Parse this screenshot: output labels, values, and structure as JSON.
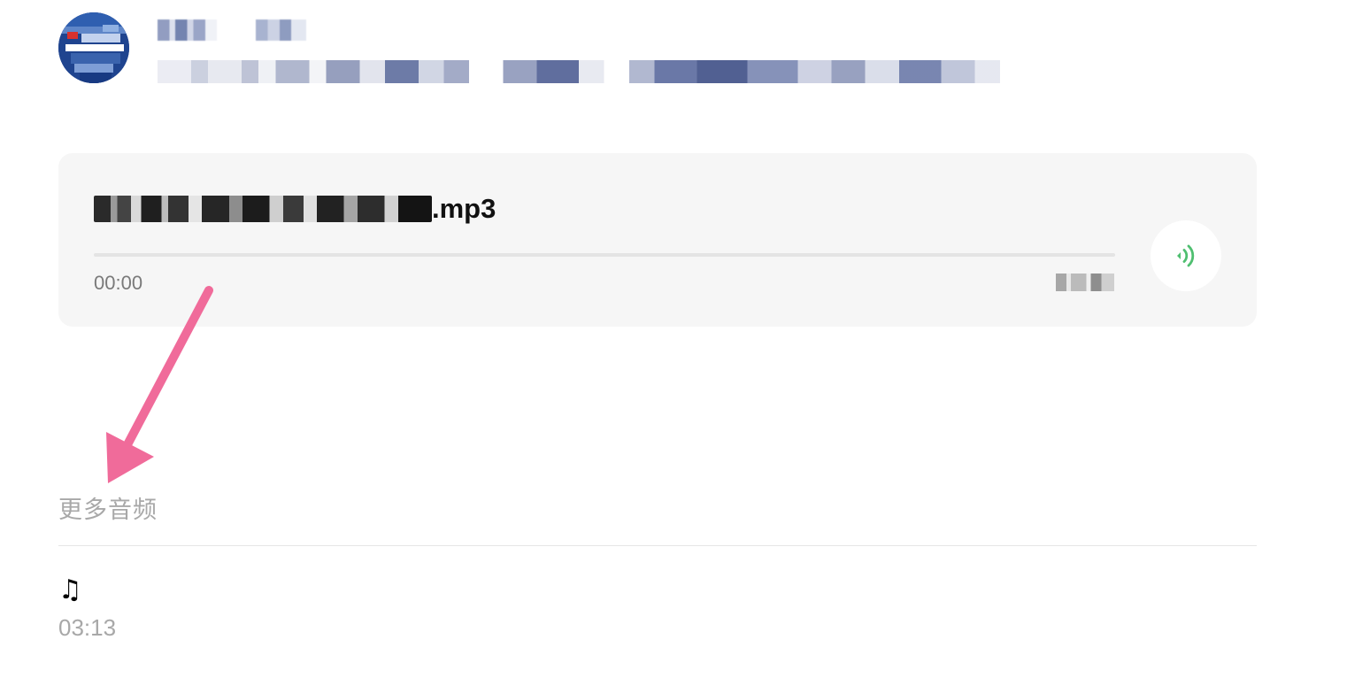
{
  "header": {
    "account_name": "▓▓▓▓ ▓▓▓",
    "account_description": "▓▓▓▓▓▓▓▓▓▓▓▓▓▓▓▓▓▓▓▓▓▓▓▓▓▓▓▓▓▓▓▓▓▓▓▓▓▓▓▓▓▓▓▓▓▓▓▓▓▓▓▓▓▓▓▓▓▓▓▓"
  },
  "audio_player": {
    "title_blurred": "▓▓▓▓▓▓▓▓▓▓▓▓▓▓▓▓▓▓▓",
    "title_extension": ".mp3",
    "current_time": "00:00",
    "total_time_blurred": "▓▓:▓▓",
    "progress": 0,
    "play_icon": "sound-wave-icon",
    "accent_color": "#07c160"
  },
  "more_audio": {
    "section_title": "更多音频",
    "items": [
      {
        "icon": "♫",
        "duration": "03:13"
      }
    ]
  },
  "colors": {
    "card_background": "#f6f6f6",
    "muted_text": "#a8a8a8",
    "annotation_arrow": "#f06b9a"
  }
}
